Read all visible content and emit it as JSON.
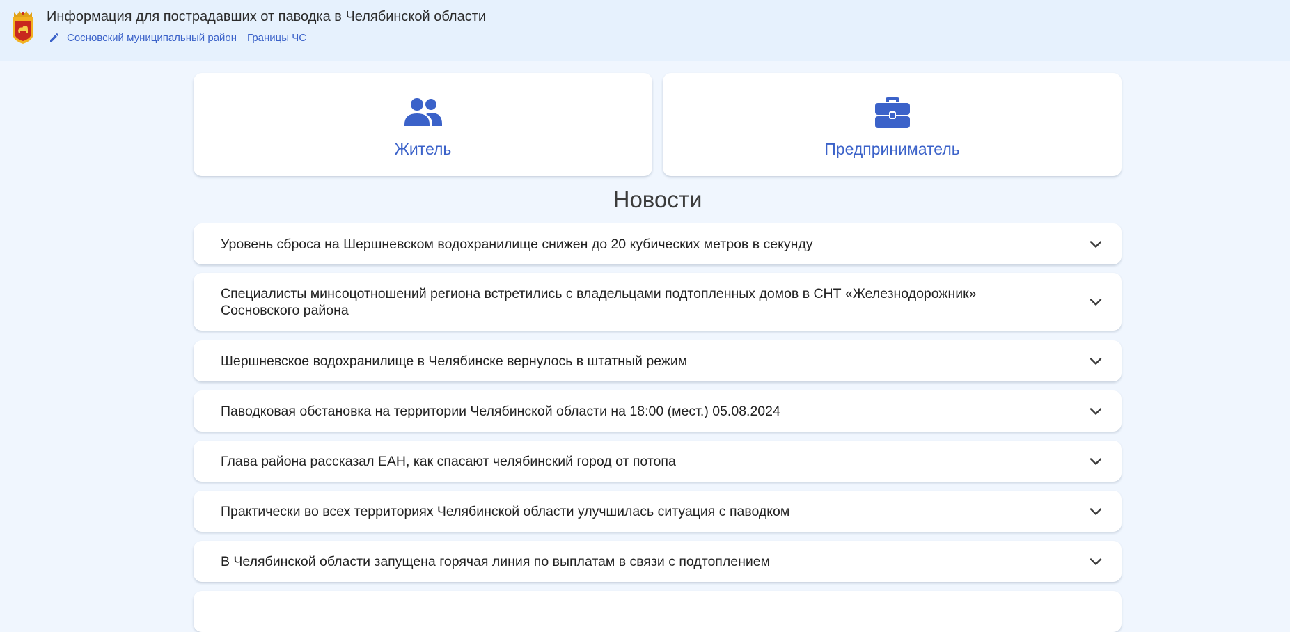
{
  "header": {
    "title": "Информация для пострадавших от паводка в Челябинской области",
    "links": [
      {
        "label": "Сосновский муниципальный район",
        "icon": "pencil-icon"
      },
      {
        "label": "Границы ЧС"
      }
    ]
  },
  "cards": [
    {
      "label": "Житель",
      "icon": "people-icon"
    },
    {
      "label": "Предприниматель",
      "icon": "briefcase-icon"
    }
  ],
  "news": {
    "title": "Новости",
    "items": [
      "Уровень сброса на Шершневском водохранилище снижен до 20 кубических метров в секунду",
      "Специалисты минсоцотношений региона встретились с владельцами подтопленных домов в СНТ «Железнодорожник» Сосновского района",
      "Шершневское водохранилище в Челябинске вернулось в штатный режим",
      "Паводковая обстановка на территории Челябинской области на 18:00 (мест.) 05.08.2024",
      "Глава района рассказал ЕАН, как спасают челябинский город от потопа",
      "Практически во всех территориях Челябинской области улучшилась ситуация с паводком",
      "В Челябинской области запущена горячая линия по выплатам в связи с подтоплением",
      ""
    ]
  },
  "colors": {
    "page_bg": "#f0f6fe",
    "header_bg": "#e6f1fd",
    "accent": "#3b62c9",
    "card_bg": "#ffffff"
  }
}
